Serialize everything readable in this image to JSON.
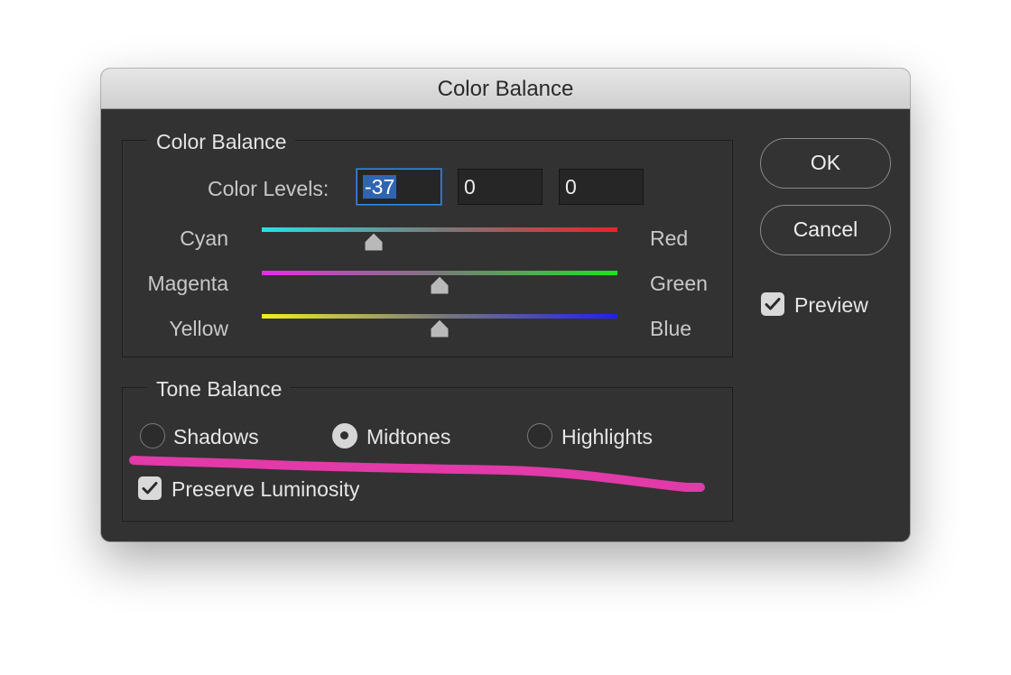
{
  "window": {
    "title": "Color Balance"
  },
  "color_balance": {
    "legend": "Color Balance",
    "levels_label": "Color Levels:",
    "levels": [
      "-37",
      "0",
      "0"
    ],
    "sliders": [
      {
        "left": "Cyan",
        "right": "Red",
        "value": -37,
        "left_color": "#29e0e6",
        "right_color": "#e8242a"
      },
      {
        "left": "Magenta",
        "right": "Green",
        "value": 0,
        "left_color": "#e52ee6",
        "right_color": "#22e022"
      },
      {
        "left": "Yellow",
        "right": "Blue",
        "value": 0,
        "left_color": "#f1ef24",
        "right_color": "#2020ef"
      }
    ]
  },
  "tone_balance": {
    "legend": "Tone Balance",
    "options": [
      "Shadows",
      "Midtones",
      "Highlights"
    ],
    "selected": "Midtones",
    "preserve_luminosity": {
      "label": "Preserve Luminosity",
      "checked": true
    }
  },
  "buttons": {
    "ok": "OK",
    "cancel": "Cancel"
  },
  "preview": {
    "label": "Preview",
    "checked": true
  },
  "annotation": {
    "color": "#e23aa8"
  }
}
